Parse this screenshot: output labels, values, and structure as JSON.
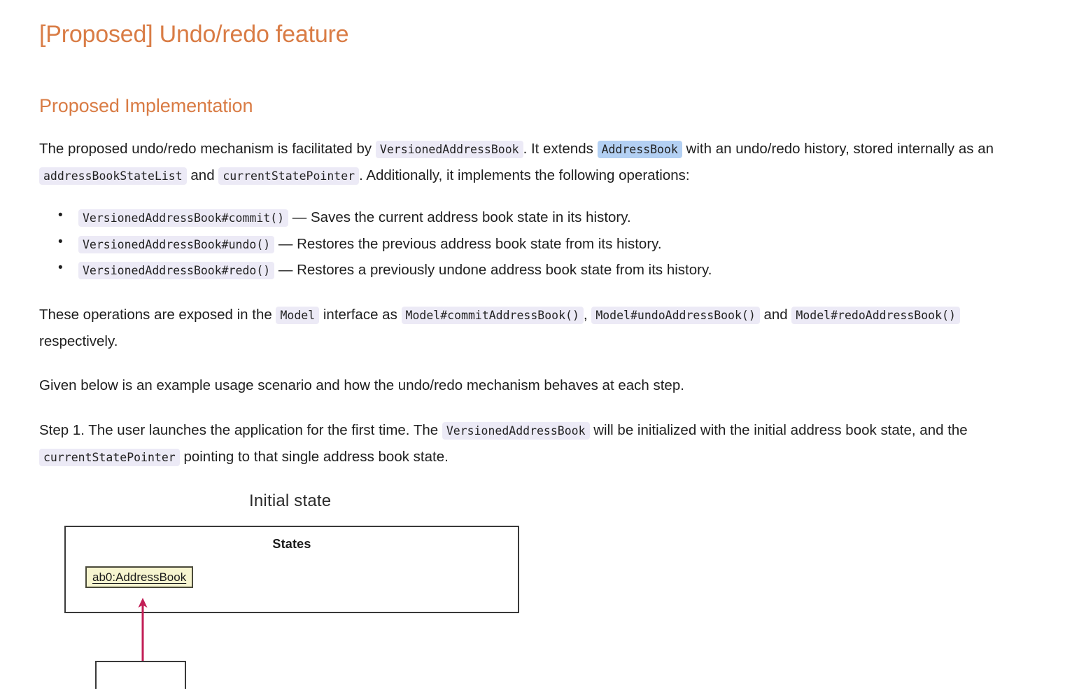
{
  "document": {
    "title": "[Proposed] Undo/redo feature",
    "section_title": "Proposed Implementation",
    "accent_color": "#d97c45",
    "selection_color": "#b3d0f3",
    "code_bg_color": "#eceaf6"
  },
  "intro": {
    "part1": "The proposed undo/redo mechanism is facilitated by",
    "code1": "VersionedAddressBook",
    "part2": ". It extends",
    "code2": "AddressBook",
    "part3": "with an undo/redo history, stored internally as an",
    "code3": "addressBookStateList",
    "part4": "and",
    "code4": "currentStatePointer",
    "part5": ". Additionally, it implements the following operations:"
  },
  "operations": [
    {
      "code": "VersionedAddressBook#commit()",
      "description": "— Saves the current address book state in its history."
    },
    {
      "code": "VersionedAddressBook#undo()",
      "description": "— Restores the previous address book state from its history."
    },
    {
      "code": "VersionedAddressBook#redo()",
      "description": "— Restores a previously undone address book state from its history."
    }
  ],
  "model_para": {
    "part1": "These operations are exposed in the",
    "code1": "Model",
    "part2": "interface as",
    "code2": "Model#commitAddressBook()",
    "comma": ",",
    "code3": "Model#undoAddressBook()",
    "part3": "and",
    "code4": "Model#redoAddressBook()",
    "part4": "respectively."
  },
  "scenario_intro": "Given below is an example usage scenario and how the undo/redo mechanism behaves at each step.",
  "step1": {
    "part1": "Step 1. The user launches the application for the first time. The",
    "code1": "VersionedAddressBook",
    "part2": "will be initialized with the initial address book state, and the",
    "code2": "currentStatePointer",
    "part3": "pointing to that single address book state."
  },
  "diagram": {
    "caption": "Initial state",
    "states_label": "States",
    "object_label": "ab0:AddressBook",
    "arrow_color": "#c21e56",
    "object_fill": "#f7f5cf"
  }
}
